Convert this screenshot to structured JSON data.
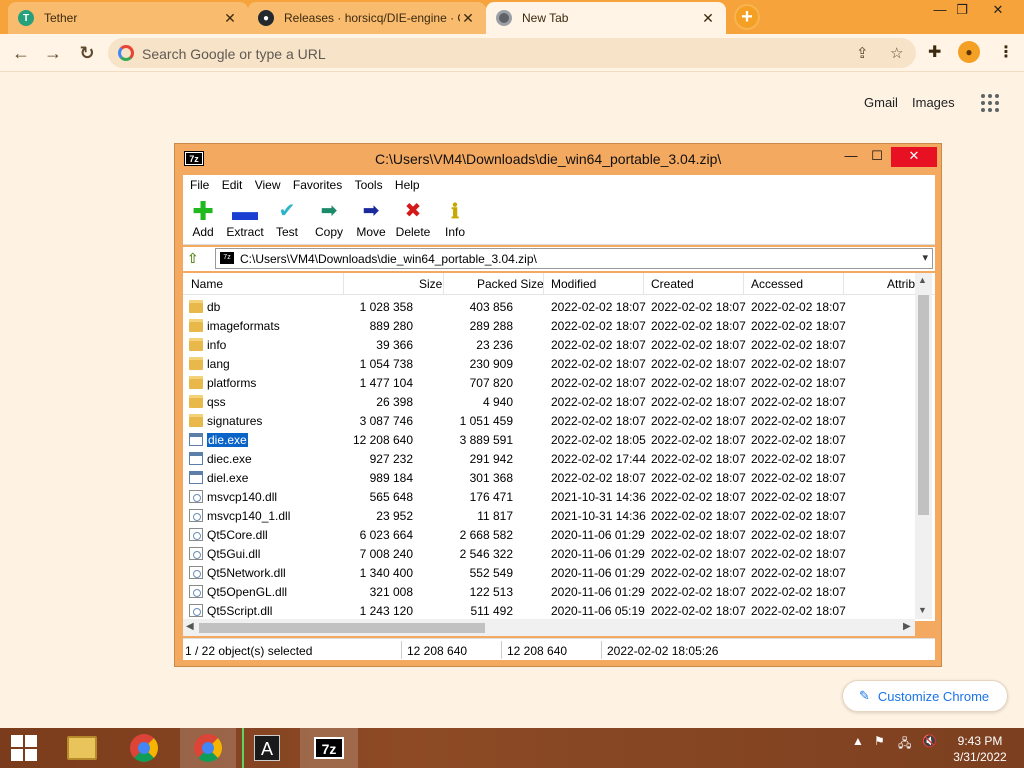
{
  "browser": {
    "tabs": [
      {
        "title": "Tether",
        "favicon_color": "#26A17B"
      },
      {
        "title": "Releases · horsicq/DIE-engine · GitH",
        "favicon_color": "#24292e"
      },
      {
        "title": "New Tab",
        "favicon_color": "#5f6368"
      }
    ],
    "omnibox_placeholder": "Search Google or type a URL",
    "ntp": {
      "gmail": "Gmail",
      "images": "Images",
      "customize": "Customize Chrome"
    }
  },
  "sevenzip": {
    "title": "C:\\Users\\VM4\\Downloads\\die_win64_portable_3.04.zip\\",
    "app_icon": "7z",
    "menu": [
      "File",
      "Edit",
      "View",
      "Favorites",
      "Tools",
      "Help"
    ],
    "toolbar": [
      "Add",
      "Extract",
      "Test",
      "Copy",
      "Move",
      "Delete",
      "Info"
    ],
    "address": "C:\\Users\\VM4\\Downloads\\die_win64_portable_3.04.zip\\",
    "columns": [
      "Name",
      "Size",
      "Packed Size",
      "Modified",
      "Created",
      "Accessed",
      "Attrib"
    ],
    "files": [
      {
        "name": "db",
        "type": "folder",
        "size": "1 028 358",
        "packed": "403 856",
        "modified": "2022-02-02 18:07",
        "created": "2022-02-02 18:07",
        "accessed": "2022-02-02 18:07"
      },
      {
        "name": "imageformats",
        "type": "folder",
        "size": "889 280",
        "packed": "289 288",
        "modified": "2022-02-02 18:07",
        "created": "2022-02-02 18:07",
        "accessed": "2022-02-02 18:07"
      },
      {
        "name": "info",
        "type": "folder",
        "size": "39 366",
        "packed": "23 236",
        "modified": "2022-02-02 18:07",
        "created": "2022-02-02 18:07",
        "accessed": "2022-02-02 18:07"
      },
      {
        "name": "lang",
        "type": "folder",
        "size": "1 054 738",
        "packed": "230 909",
        "modified": "2022-02-02 18:07",
        "created": "2022-02-02 18:07",
        "accessed": "2022-02-02 18:07"
      },
      {
        "name": "platforms",
        "type": "folder",
        "size": "1 477 104",
        "packed": "707 820",
        "modified": "2022-02-02 18:07",
        "created": "2022-02-02 18:07",
        "accessed": "2022-02-02 18:07"
      },
      {
        "name": "qss",
        "type": "folder",
        "size": "26 398",
        "packed": "4 940",
        "modified": "2022-02-02 18:07",
        "created": "2022-02-02 18:07",
        "accessed": "2022-02-02 18:07"
      },
      {
        "name": "signatures",
        "type": "folder",
        "size": "3 087 746",
        "packed": "1 051 459",
        "modified": "2022-02-02 18:07",
        "created": "2022-02-02 18:07",
        "accessed": "2022-02-02 18:07"
      },
      {
        "name": "die.exe",
        "type": "exe",
        "size": "12 208 640",
        "packed": "3 889 591",
        "modified": "2022-02-02 18:05",
        "created": "2022-02-02 18:07",
        "accessed": "2022-02-02 18:07",
        "selected": true
      },
      {
        "name": "diec.exe",
        "type": "exe",
        "size": "927 232",
        "packed": "291 942",
        "modified": "2022-02-02 17:44",
        "created": "2022-02-02 18:07",
        "accessed": "2022-02-02 18:07"
      },
      {
        "name": "diel.exe",
        "type": "exe",
        "size": "989 184",
        "packed": "301 368",
        "modified": "2022-02-02 18:07",
        "created": "2022-02-02 18:07",
        "accessed": "2022-02-02 18:07"
      },
      {
        "name": "msvcp140.dll",
        "type": "dll",
        "size": "565 648",
        "packed": "176 471",
        "modified": "2021-10-31 14:36",
        "created": "2022-02-02 18:07",
        "accessed": "2022-02-02 18:07"
      },
      {
        "name": "msvcp140_1.dll",
        "type": "dll",
        "size": "23 952",
        "packed": "11 817",
        "modified": "2021-10-31 14:36",
        "created": "2022-02-02 18:07",
        "accessed": "2022-02-02 18:07"
      },
      {
        "name": "Qt5Core.dll",
        "type": "dll",
        "size": "6 023 664",
        "packed": "2 668 582",
        "modified": "2020-11-06 01:29",
        "created": "2022-02-02 18:07",
        "accessed": "2022-02-02 18:07"
      },
      {
        "name": "Qt5Gui.dll",
        "type": "dll",
        "size": "7 008 240",
        "packed": "2 546 322",
        "modified": "2020-11-06 01:29",
        "created": "2022-02-02 18:07",
        "accessed": "2022-02-02 18:07"
      },
      {
        "name": "Qt5Network.dll",
        "type": "dll",
        "size": "1 340 400",
        "packed": "552 549",
        "modified": "2020-11-06 01:29",
        "created": "2022-02-02 18:07",
        "accessed": "2022-02-02 18:07"
      },
      {
        "name": "Qt5OpenGL.dll",
        "type": "dll",
        "size": "321 008",
        "packed": "122 513",
        "modified": "2020-11-06 01:29",
        "created": "2022-02-02 18:07",
        "accessed": "2022-02-02 18:07"
      },
      {
        "name": "Qt5Script.dll",
        "type": "dll",
        "size": "1 243 120",
        "packed": "511 492",
        "modified": "2020-11-06 05:19",
        "created": "2022-02-02 18:07",
        "accessed": "2022-02-02 18:07"
      }
    ],
    "status": {
      "selection": "1 / 22 object(s) selected",
      "size": "12 208 640",
      "packed": "12 208 640",
      "modified": "2022-02-02 18:05:26"
    }
  },
  "taskbar": {
    "time": "9:43 PM",
    "date": "3/31/2022",
    "terminal_label": "A",
    "sevenzip_label": "7z"
  },
  "colors": {
    "accent_tabstrip": "#F7A33B",
    "selection": "#0A64C8"
  }
}
